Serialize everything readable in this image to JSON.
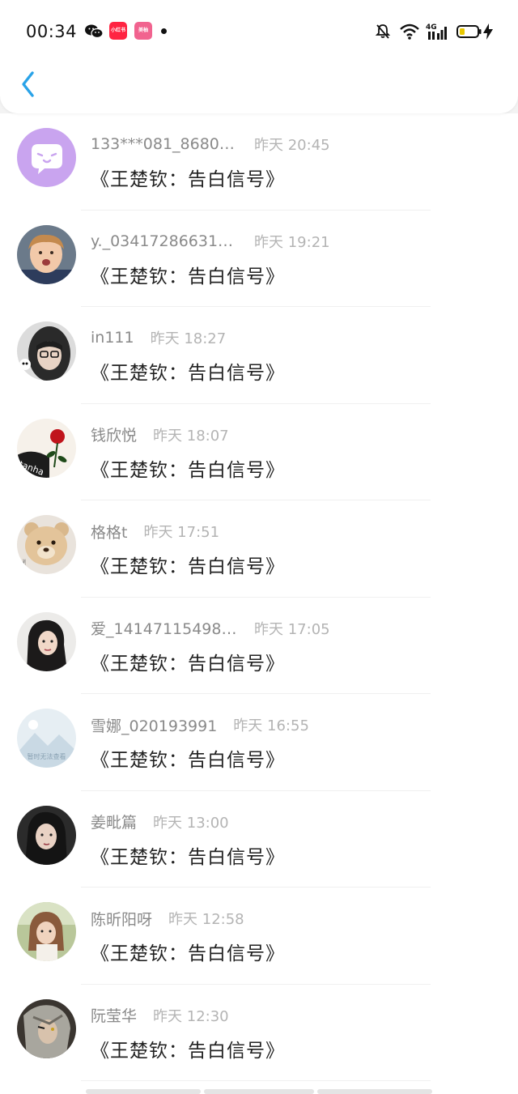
{
  "status_bar": {
    "time": "00:34",
    "app_icon_1_label": "小红书",
    "app_icon_2_label": "美柚",
    "network_label": "4G"
  },
  "header": {
    "back_icon": "chevron-left-icon",
    "accent_color": "#2aa3e8"
  },
  "items": [
    {
      "username": "133***081_86806...",
      "time": "昨天 20:45",
      "message": "《王楚钦：告白信号》",
      "avatar": "default-purple-avatar",
      "truncated": true
    },
    {
      "username": "y._034172866310...",
      "time": "昨天 19:21",
      "message": "《王楚钦：告白信号》",
      "avatar": "child-photo-avatar",
      "truncated": true
    },
    {
      "username": "in111",
      "time": "昨天 18:27",
      "message": "《王楚钦：告白信号》",
      "avatar": "glasses-girl-avatar",
      "truncated": false
    },
    {
      "username": "钱欣悦",
      "time": "昨天 18:07",
      "message": "《王楚钦：告白信号》",
      "avatar": "rose-avatar",
      "truncated": false
    },
    {
      "username": "格格t",
      "time": "昨天 17:51",
      "message": "《王楚钦：告白信号》",
      "avatar": "teddy-bear-avatar",
      "truncated": false
    },
    {
      "username": "爱_141471154981...",
      "time": "昨天 17:05",
      "message": "《王楚钦：告白信号》",
      "avatar": "girl-portrait-avatar",
      "truncated": true
    },
    {
      "username": "雪娜_020193991",
      "time": "昨天 16:55",
      "message": "《王楚钦：告白信号》",
      "avatar": "placeholder-landscape-avatar",
      "placeholder_text": "暂时无法查看",
      "truncated": false
    },
    {
      "username": "姜毗篇",
      "time": "昨天 13:00",
      "message": "《王楚钦：告白信号》",
      "avatar": "dark-hair-girl-avatar",
      "truncated": false
    },
    {
      "username": "陈昕阳呀",
      "time": "昨天 12:58",
      "message": "《王楚钦：告白信号》",
      "avatar": "outdoor-girl-avatar",
      "truncated": false
    },
    {
      "username": "阮莹华",
      "time": "昨天 12:30",
      "message": "《王楚钦：告白信号》",
      "avatar": "anime-character-avatar",
      "truncated": false
    }
  ]
}
